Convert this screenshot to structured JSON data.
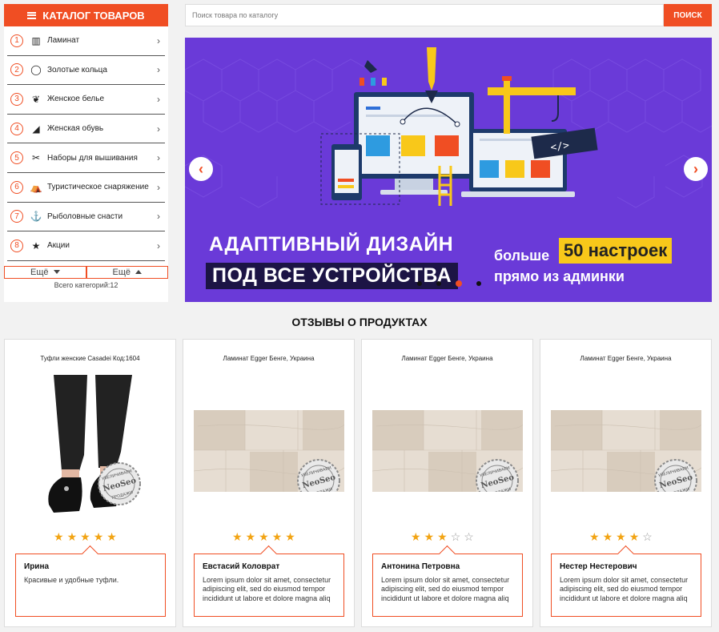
{
  "catalog": {
    "title": "КАТАЛОГ ТОВАРОВ",
    "items": [
      {
        "num": "1",
        "icon": "laminate-icon",
        "glyph": "▥",
        "label": "Ламинат"
      },
      {
        "num": "2",
        "icon": "ring-icon",
        "glyph": "◯",
        "label": "Золотые кольца"
      },
      {
        "num": "3",
        "icon": "underwear-icon",
        "glyph": "❦",
        "label": "Женское белье"
      },
      {
        "num": "4",
        "icon": "shoe-icon",
        "glyph": "◢",
        "label": "Женская обувь"
      },
      {
        "num": "5",
        "icon": "sewing-machine-icon",
        "glyph": "✂",
        "label": "Наборы для вышивания"
      },
      {
        "num": "6",
        "icon": "tent-icon",
        "glyph": "⛺",
        "label": "Туристическое снаряжение"
      },
      {
        "num": "7",
        "icon": "fishing-icon",
        "glyph": "⚓",
        "label": "Рыболовные снасти"
      },
      {
        "num": "8",
        "icon": "stars-icon",
        "glyph": "★",
        "label": "Акции"
      }
    ],
    "more_label_1": "Ещё",
    "more_label_2": "Ещё",
    "total": "Всего категорий:12"
  },
  "search": {
    "placeholder": "Поиск товара по каталогу",
    "button": "ПОИСК"
  },
  "banner": {
    "headline_1": "АДАПТИВНЫЙ ДИЗАЙН",
    "headline_2": "ПОД ВСЕ УСТРОЙСТВА",
    "right_1": "больше",
    "highlight": "50 настроек",
    "right_2": "прямо из админки",
    "code_tag": "</>",
    "prev_icon": "chevron-left-icon",
    "next_icon": "chevron-right-icon",
    "slides": 4,
    "active_slide": 3
  },
  "reviews": {
    "title": "ОТЗЫВЫ О ПРОДУКТАХ",
    "cards": [
      {
        "product": "Туфли женские Casadei Код:1604",
        "image": "shoes",
        "rating": 5,
        "name": "Ирина",
        "text": "Красивые и удобные туфли."
      },
      {
        "product": "Ламинат Egger Бенге, Украина",
        "image": "laminate",
        "rating": 5,
        "name": "Евстасий Коловрат",
        "text": "Lorem ipsum dolor sit amet, consectetur adipiscing elit, sed do eiusmod tempor incididunt ut labore et dolore magna aliq"
      },
      {
        "product": "Ламинат Egger Бенге, Украина",
        "image": "laminate",
        "rating": 3,
        "name": "Антонина Петровна",
        "text": "Lorem ipsum dolor sit amet, consectetur adipiscing elit, sed do eiusmod tempor incididunt ut labore et dolore magna aliq"
      },
      {
        "product": "Ламинат Egger Бенге, Украина",
        "image": "laminate",
        "rating": 4,
        "name": "Нестер Нестерович",
        "text": "Lorem ipsum dolor sit amet, consectetur adipiscing elit, sed do eiusmod tempor incididunt ut labore et dolore magna aliq"
      }
    ],
    "max_rating": 5
  },
  "colors": {
    "accent": "#f04e23",
    "banner_bg": "#6a3ad8",
    "star": "#f2a414",
    "highlight": "#f8c81a"
  }
}
